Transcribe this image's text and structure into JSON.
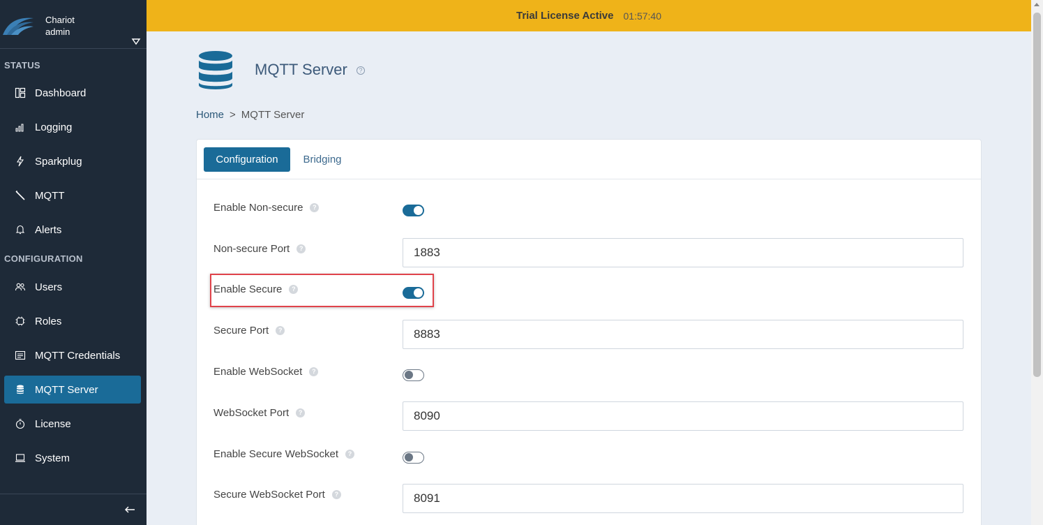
{
  "sidebar": {
    "app_name": "Chariot",
    "user": "admin",
    "status_label": "STATUS",
    "configuration_label": "CONFIGURATION",
    "status_items": [
      {
        "label": "Dashboard",
        "icon": "dashboard-icon"
      },
      {
        "label": "Logging",
        "icon": "bar-chart-icon"
      },
      {
        "label": "Sparkplug",
        "icon": "lightning-icon"
      },
      {
        "label": "MQTT",
        "icon": "wand-icon"
      },
      {
        "label": "Alerts",
        "icon": "bell-icon"
      }
    ],
    "config_items": [
      {
        "label": "Users",
        "icon": "users-icon"
      },
      {
        "label": "Roles",
        "icon": "roles-icon"
      },
      {
        "label": "MQTT Credentials",
        "icon": "credentials-icon"
      },
      {
        "label": "MQTT Server",
        "icon": "database-icon",
        "active": true
      },
      {
        "label": "License",
        "icon": "timer-icon"
      },
      {
        "label": "System",
        "icon": "laptop-icon"
      }
    ]
  },
  "banner": {
    "title": "Trial License Active",
    "time": "01:57:40",
    "color": "#efb319"
  },
  "header": {
    "title": "MQTT Server",
    "help": "?"
  },
  "breadcrumb": {
    "home": "Home",
    "separator": ">",
    "current": "MQTT Server"
  },
  "tabs": {
    "configuration": "Configuration",
    "bridging": "Bridging"
  },
  "form": {
    "enable_non_secure": {
      "label": "Enable Non-secure",
      "on": true
    },
    "non_secure_port": {
      "label": "Non-secure Port",
      "value": "1883"
    },
    "enable_secure": {
      "label": "Enable Secure",
      "on": true
    },
    "secure_port": {
      "label": "Secure Port",
      "value": "8883"
    },
    "enable_websocket": {
      "label": "Enable WebSocket",
      "on": false
    },
    "websocket_port": {
      "label": "WebSocket Port",
      "value": "8090"
    },
    "enable_secure_websocket": {
      "label": "Enable Secure WebSocket",
      "on": false
    },
    "secure_websocket_port": {
      "label": "Secure WebSocket Port",
      "value": "8091"
    }
  },
  "colors": {
    "accent": "#1a6b98",
    "sidebar": "#1e2a38",
    "highlight": "#e0434b"
  }
}
